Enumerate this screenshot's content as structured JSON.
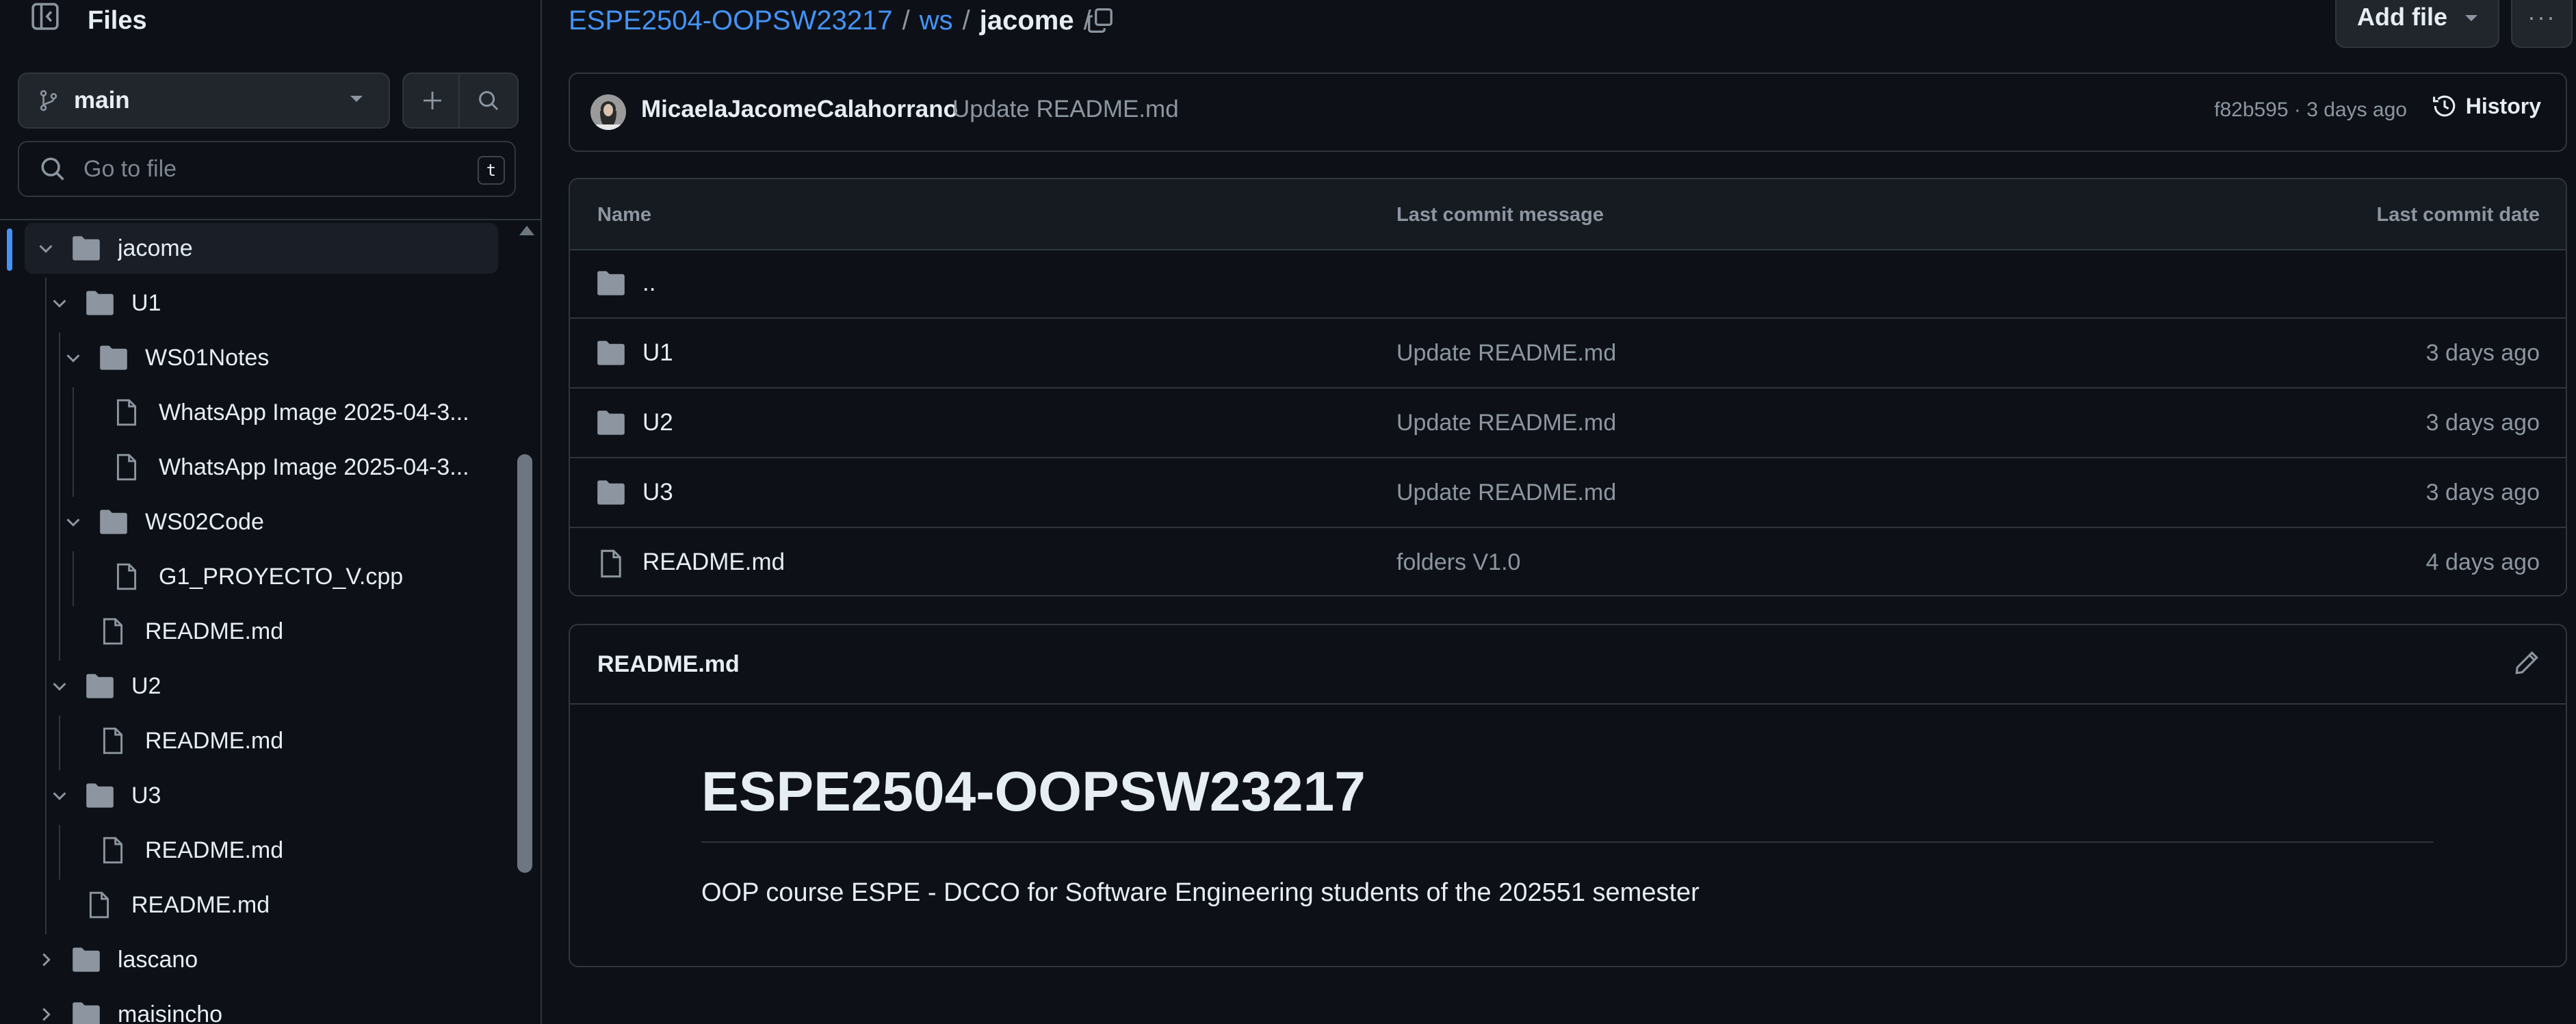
{
  "sidebar": {
    "title": "Files",
    "branch": "main",
    "goto_placeholder": "Go to file",
    "goto_shortcut": "t",
    "tree": [
      {
        "label": "jacome",
        "type": "folder",
        "level": 0,
        "expanded": true,
        "active": true
      },
      {
        "label": "U1",
        "type": "folder",
        "level": 1,
        "expanded": true
      },
      {
        "label": "WS01Notes",
        "type": "folder",
        "level": 2,
        "expanded": true
      },
      {
        "label": "WhatsApp Image 2025-04-3...",
        "type": "file",
        "level": 3
      },
      {
        "label": "WhatsApp Image 2025-04-3...",
        "type": "file",
        "level": 3
      },
      {
        "label": "WS02Code",
        "type": "folder",
        "level": 2,
        "expanded": true
      },
      {
        "label": "G1_PROYECTO_V.cpp",
        "type": "file",
        "level": 3
      },
      {
        "label": "README.md",
        "type": "file",
        "level": 2
      },
      {
        "label": "U2",
        "type": "folder",
        "level": 1,
        "expanded": true
      },
      {
        "label": "README.md",
        "type": "file",
        "level": 2
      },
      {
        "label": "U3",
        "type": "folder",
        "level": 1,
        "expanded": true
      },
      {
        "label": "README.md",
        "type": "file",
        "level": 2
      },
      {
        "label": "README.md",
        "type": "file",
        "level": 1
      },
      {
        "label": "lascano",
        "type": "folder",
        "level": 0,
        "expanded": false
      },
      {
        "label": "maisincho",
        "type": "folder",
        "level": 0,
        "expanded": false
      }
    ]
  },
  "breadcrumb": {
    "repo": "ESPE2504-OOPSW23217",
    "folder": "ws",
    "current": "jacome",
    "sep": "/"
  },
  "toolbar": {
    "add_file": "Add file",
    "more": "···"
  },
  "commit": {
    "author": "MicaelaJacomeCalahorrano",
    "message": "Update README.md",
    "meta": "f82b595 · 3 days ago",
    "history": "History"
  },
  "table": {
    "headers": {
      "name": "Name",
      "message": "Last commit message",
      "date": "Last commit date"
    },
    "rows": [
      {
        "name": "..",
        "type": "folder",
        "message": "",
        "date": ""
      },
      {
        "name": "U1",
        "type": "folder",
        "message": "Update README.md",
        "date": "3 days ago"
      },
      {
        "name": "U2",
        "type": "folder",
        "message": "Update README.md",
        "date": "3 days ago"
      },
      {
        "name": "U3",
        "type": "folder",
        "message": "Update README.md",
        "date": "3 days ago"
      },
      {
        "name": "README.md",
        "type": "file",
        "message": "folders V1.0",
        "date": "4 days ago"
      }
    ]
  },
  "readme": {
    "filename": "README.md",
    "heading": "ESPE2504-OOPSW23217",
    "paragraph": "OOP course ESPE - DCCO for Software Engineering students of the 202551 semester"
  },
  "colors": {
    "background": "#0d1117",
    "border": "#30363d",
    "link": "#4493f8",
    "muted": "#8d96a0",
    "text": "#e6edf3"
  }
}
